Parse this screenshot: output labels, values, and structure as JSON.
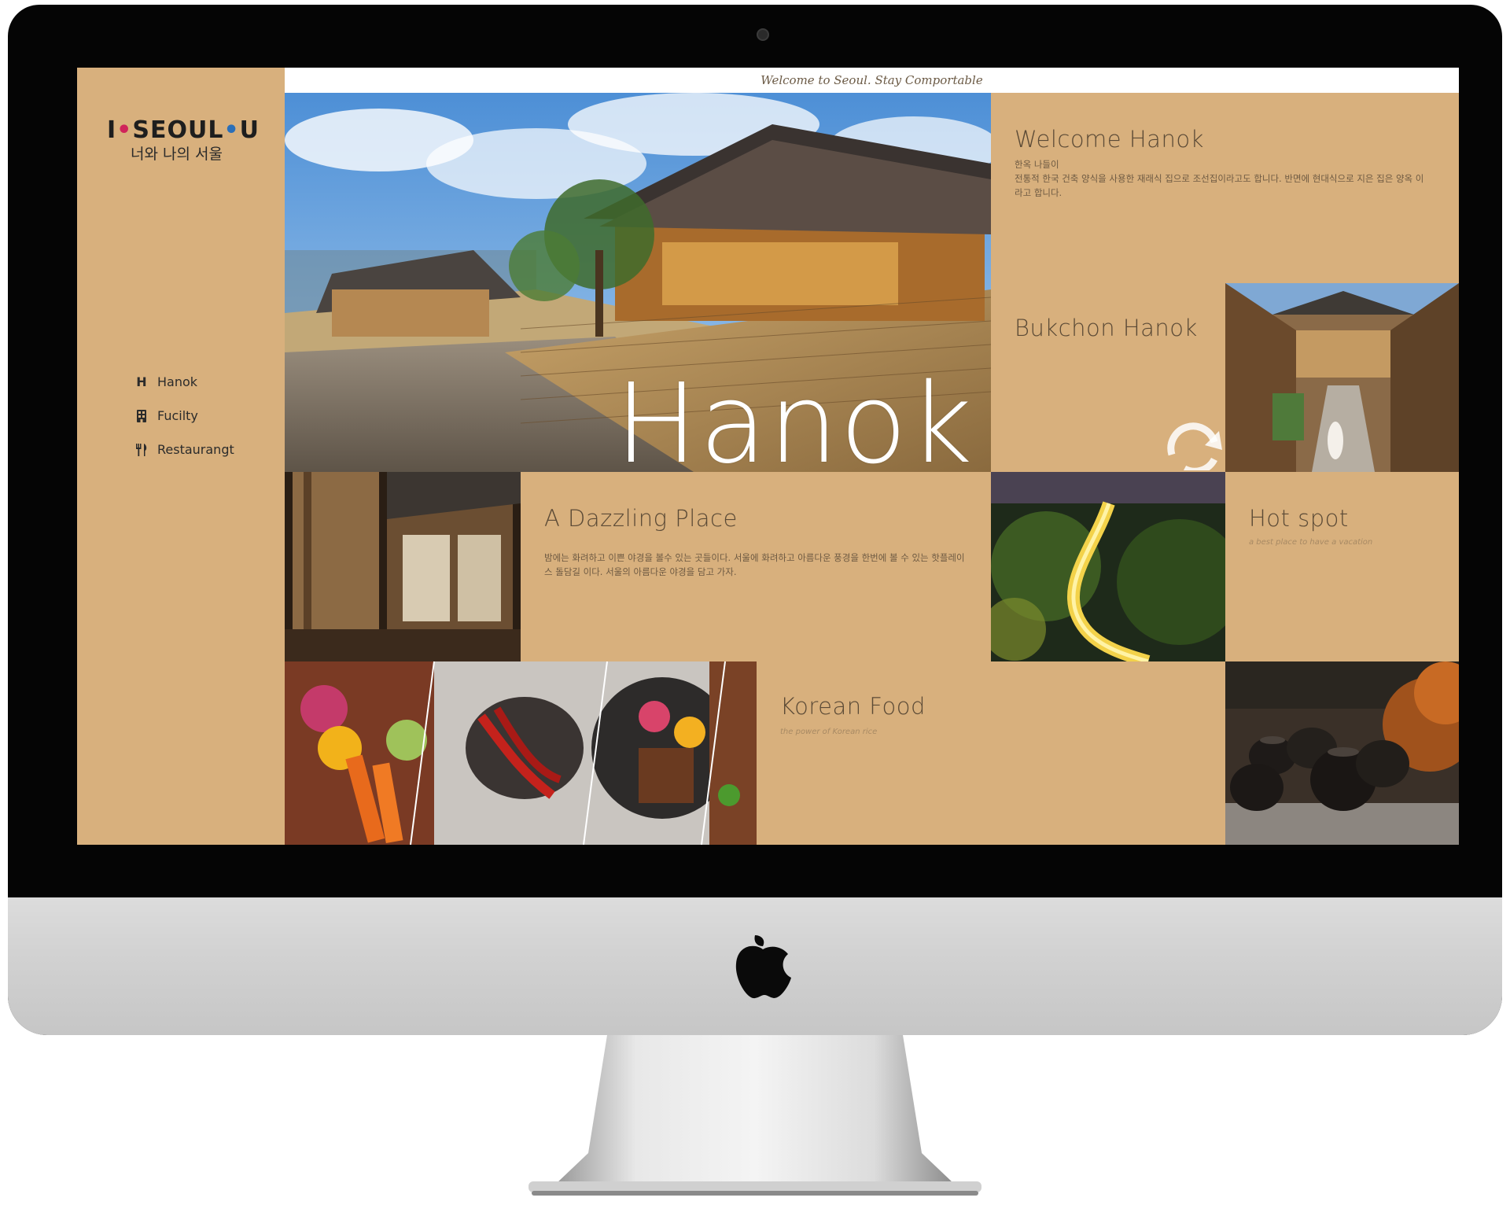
{
  "topbar": {
    "message": "Welcome to Seoul. Stay Comportable"
  },
  "brand": {
    "logo_main_left": "I",
    "logo_main_right": "SEOUL",
    "logo_main_u": "U",
    "logo_sub": "너와 나의 서울"
  },
  "nav": {
    "items": [
      {
        "label": "Hanok",
        "icon": "hanok-h-icon"
      },
      {
        "label": "Fucilty",
        "icon": "building-icon"
      },
      {
        "label": "Restaurangt",
        "icon": "fork-knife-icon"
      }
    ]
  },
  "hero": {
    "word": "Hanok"
  },
  "sections": {
    "welcome": {
      "title": "Welcome Hanok",
      "line1": "한옥 나들이",
      "line2": "전통적 한국 건축 양식을 사용한 재래식 집으로 조선집이라고도 합니다. 반면에 현대식으로 지은 집은 양옥 이라고 합니다."
    },
    "bukchon": {
      "title": "Bukchon Hanok"
    },
    "dazzling": {
      "title": "A Dazzling Place",
      "text": "밤에는 화려하고 이쁜 야경을 볼수 있는 곳들이다. 서울에 화려하고 아름다운 풍경을 한번에 볼 수 있는 핫플레이스 돌담길 이다. 서울의 아름다운 야경을 담고 가자."
    },
    "hotspot": {
      "title": "Hot spot",
      "subtitle": "a best place to have a vacation"
    },
    "food": {
      "title": "Korean Food",
      "subtitle": "the power of Korean rice"
    }
  },
  "colors": {
    "screen_bg": "#d8b07d",
    "title_text": "#5b4a36",
    "topbar_bg": "#ffffff",
    "accent_pink": "#d0245a",
    "accent_blue": "#2b6fb8"
  }
}
